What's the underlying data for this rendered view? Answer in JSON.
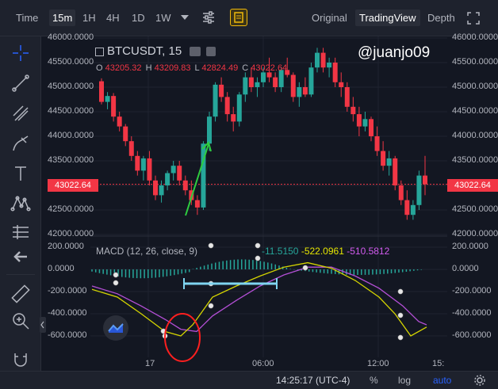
{
  "toolbar": {
    "timeframes": [
      "Time",
      "15m",
      "1H",
      "4H",
      "1D",
      "1W"
    ],
    "active_timeframe": "15m",
    "views": [
      "Original",
      "TradingView",
      "Depth"
    ],
    "active_view": "TradingView"
  },
  "chart": {
    "symbol": "BTCUSDT, 15",
    "ohlc": {
      "o_label": "O",
      "o": "43205.32",
      "h_label": "H",
      "h": "43209.83",
      "l_label": "L",
      "l": "42824.49",
      "c_label": "C",
      "c": "43022.64"
    },
    "watermark": "@juanjo09",
    "current_price": "43022.64",
    "price_axis": [
      "46000.0000",
      "45500.0000",
      "45000.0000",
      "44500.0000",
      "44000.0000",
      "43500.0000",
      "43000.0000",
      "42500.0000",
      "42000.0000"
    ],
    "price_axis_right": [
      "46000.0000",
      "45500.0000",
      "45000.0000",
      "44500.0000",
      "44000.0000",
      "43500.0000",
      "42500.0000",
      "42000.0000"
    ],
    "macd_label": "MACD (12, 26, close, 9)",
    "macd_values": {
      "hist": "-11.5150",
      "macd": "-522.0961",
      "signal": "-510.5812"
    },
    "macd_axis": [
      "200.0000",
      "0.0000",
      "-200.0000",
      "-400.0000",
      "-600.0000"
    ],
    "time_axis": [
      "17",
      "06:00",
      "12:00",
      "15:"
    ],
    "colors": {
      "up": "#26a69a",
      "down": "#f23645",
      "macd_line": "#e6e600",
      "signal_line": "#b44fd6",
      "hist_pos": "#26a69a",
      "hist_neg": "#26a69a"
    }
  },
  "status": {
    "time": "14:25:17 (UTC-4)",
    "percent": "%",
    "log": "log",
    "auto": "auto"
  },
  "candles": [
    [
      45120,
      45180,
      44650,
      44700
    ],
    [
      44700,
      44900,
      44550,
      44820
    ],
    [
      44820,
      44880,
      44300,
      44400
    ],
    [
      44400,
      44500,
      44100,
      44200
    ],
    [
      44200,
      44250,
      43800,
      43900
    ],
    [
      43900,
      44000,
      43500,
      43600
    ],
    [
      43600,
      43700,
      43200,
      43300
    ],
    [
      43300,
      43600,
      43100,
      43550
    ],
    [
      43550,
      43700,
      43000,
      43100
    ],
    [
      43100,
      43200,
      42700,
      42800
    ],
    [
      42800,
      43100,
      42650,
      43000
    ],
    [
      43000,
      43300,
      42900,
      43250
    ],
    [
      43250,
      43500,
      43100,
      43400
    ],
    [
      43400,
      43500,
      43000,
      43100
    ],
    [
      43100,
      43200,
      42800,
      42900
    ],
    [
      42900,
      43100,
      42600,
      42700
    ],
    [
      42700,
      42800,
      42400,
      42550
    ],
    [
      42550,
      43900,
      42500,
      43850
    ],
    [
      43850,
      44500,
      43700,
      44400
    ],
    [
      44400,
      45100,
      44300,
      45050
    ],
    [
      45050,
      45200,
      44700,
      44800
    ],
    [
      44800,
      44900,
      44300,
      44450
    ],
    [
      44450,
      44600,
      44100,
      44300
    ],
    [
      44300,
      44900,
      44200,
      44850
    ],
    [
      44850,
      45300,
      44700,
      45200
    ],
    [
      45200,
      45400,
      44900,
      45000
    ],
    [
      45000,
      45200,
      44800,
      45100
    ],
    [
      45100,
      45400,
      45000,
      45300
    ],
    [
      45300,
      45600,
      45100,
      45200
    ],
    [
      45200,
      45300,
      44900,
      45000
    ],
    [
      45000,
      45400,
      44900,
      45350
    ],
    [
      45350,
      45600,
      45200,
      45250
    ],
    [
      45250,
      45300,
      44700,
      44800
    ],
    [
      44800,
      45100,
      44600,
      45000
    ],
    [
      45000,
      45200,
      44800,
      44850
    ],
    [
      44850,
      45500,
      44800,
      45400
    ],
    [
      45400,
      45800,
      45300,
      45700
    ],
    [
      45700,
      45800,
      45300,
      45400
    ],
    [
      45400,
      45600,
      45200,
      45500
    ],
    [
      45500,
      45600,
      45000,
      45100
    ],
    [
      45100,
      45300,
      44800,
      45000
    ],
    [
      45000,
      45100,
      44500,
      44600
    ],
    [
      44600,
      44800,
      44300,
      44450
    ],
    [
      44450,
      44600,
      44000,
      44200
    ],
    [
      44200,
      44500,
      44100,
      44350
    ],
    [
      44350,
      44400,
      43900,
      44000
    ],
    [
      44000,
      44200,
      43600,
      43700
    ],
    [
      43700,
      43900,
      43300,
      43400
    ],
    [
      43400,
      43700,
      43200,
      43550
    ],
    [
      43550,
      43600,
      42900,
      43000
    ],
    [
      43000,
      43100,
      42600,
      42700
    ],
    [
      42700,
      42900,
      42300,
      42400
    ],
    [
      42400,
      42700,
      42300,
      42600
    ],
    [
      42600,
      43300,
      42500,
      43200
    ],
    [
      43200,
      43600,
      42800,
      43022
    ]
  ]
}
